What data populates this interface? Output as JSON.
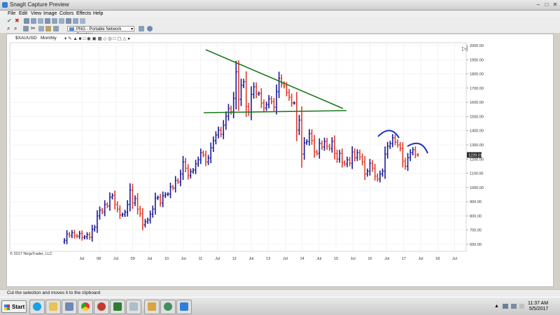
{
  "window": {
    "title": "SnagIt Capture Preview"
  },
  "menu": [
    "File",
    "Edit",
    "View",
    "Image",
    "Colors",
    "Effects",
    "Help"
  ],
  "toolbar": {
    "format_label": "PNG - Portable Network Graphics"
  },
  "chart_header": {
    "symbol": "$XAUUSD",
    "interval": "Monthly"
  },
  "status": {
    "text": "Cut the selection and moves it to the clipboard"
  },
  "taskbar": {
    "start_label": "Start",
    "time": "11:37 AM",
    "date": "5/5/2017"
  },
  "chart_data": {
    "type": "ohlc",
    "copyright": "© 2017 NinjaTrader, LLC",
    "ylim": [
      600,
      2000
    ],
    "y_ticks": [
      600,
      700,
      800,
      900,
      1000,
      1100,
      1200,
      1300,
      1400,
      1500,
      1600,
      1700,
      1800,
      1900,
      2000
    ],
    "y_tick_labels": [
      "600.00",
      "700.00",
      "800.00",
      "900.00",
      "1000.00",
      "1100.00",
      "1200.00",
      "1300.00",
      "1400.00",
      "1500.00",
      "1600.00",
      "1700.00",
      "1800.00",
      "1900.00",
      "2000.00"
    ],
    "x_tick_labels": [
      "Jul",
      "08",
      "Jul",
      "09",
      "Jul",
      "10",
      "Jul",
      "11",
      "Jul",
      "12",
      "Jul",
      "13",
      "Jul",
      "14",
      "Jul",
      "15",
      "Jul",
      "16",
      "Jul",
      "17",
      "Jul",
      "18",
      "Jul"
    ],
    "last_price": 1229.01,
    "last_price_label": "1229.01",
    "up_color": "#1a1a99",
    "down_color": "#e03c2c",
    "prices": [
      628,
      672,
      662,
      682,
      660,
      656,
      676,
      648,
      652,
      668,
      650,
      706,
      720,
      800,
      840,
      828,
      880,
      870,
      932,
      944,
      880,
      848,
      806,
      810,
      826,
      880,
      982,
      892,
      922,
      848,
      816,
      738,
      760,
      772,
      812,
      848,
      925,
      930,
      891,
      942,
      952,
      954,
      1004,
      996,
      1050,
      1040,
      1095,
      1180,
      1135,
      1085,
      1112,
      1122,
      1167,
      1195,
      1245,
      1230,
      1180,
      1208,
      1280,
      1330,
      1370,
      1405,
      1375,
      1440,
      1502,
      1557,
      1533,
      1628,
      1815,
      1620,
      1720,
      1745,
      1570,
      1530,
      1656,
      1710,
      1659,
      1663,
      1595,
      1560,
      1584,
      1625,
      1605,
      1565,
      1675,
      1770,
      1730,
      1715,
      1670,
      1635,
      1595,
      1595,
      1405,
      1475,
      1235,
      1315,
      1325,
      1380,
      1330,
      1250,
      1240,
      1310,
      1285,
      1325,
      1290,
      1275,
      1325,
      1240,
      1200,
      1240,
      1175,
      1165,
      1195,
      1170,
      1250,
      1210,
      1245,
      1215,
      1180,
      1095,
      1115,
      1170,
      1135,
      1080,
      1060,
      1095,
      1115,
      1235,
      1290,
      1310,
      1350,
      1320,
      1300,
      1275,
      1185,
      1150,
      1210,
      1245,
      1265,
      1230,
      1229
    ]
  },
  "annotations": {
    "trend_color": "#1e7a1e",
    "arc_color": "#1f33c8"
  },
  "icons": [
    "snagit-icon",
    "checkmark-icon",
    "cancel-icon",
    "cut-icon",
    "copy-icon",
    "paste-icon",
    "zoom-in-icon",
    "zoom-out-icon",
    "crop-icon",
    "start-flag-icon"
  ]
}
